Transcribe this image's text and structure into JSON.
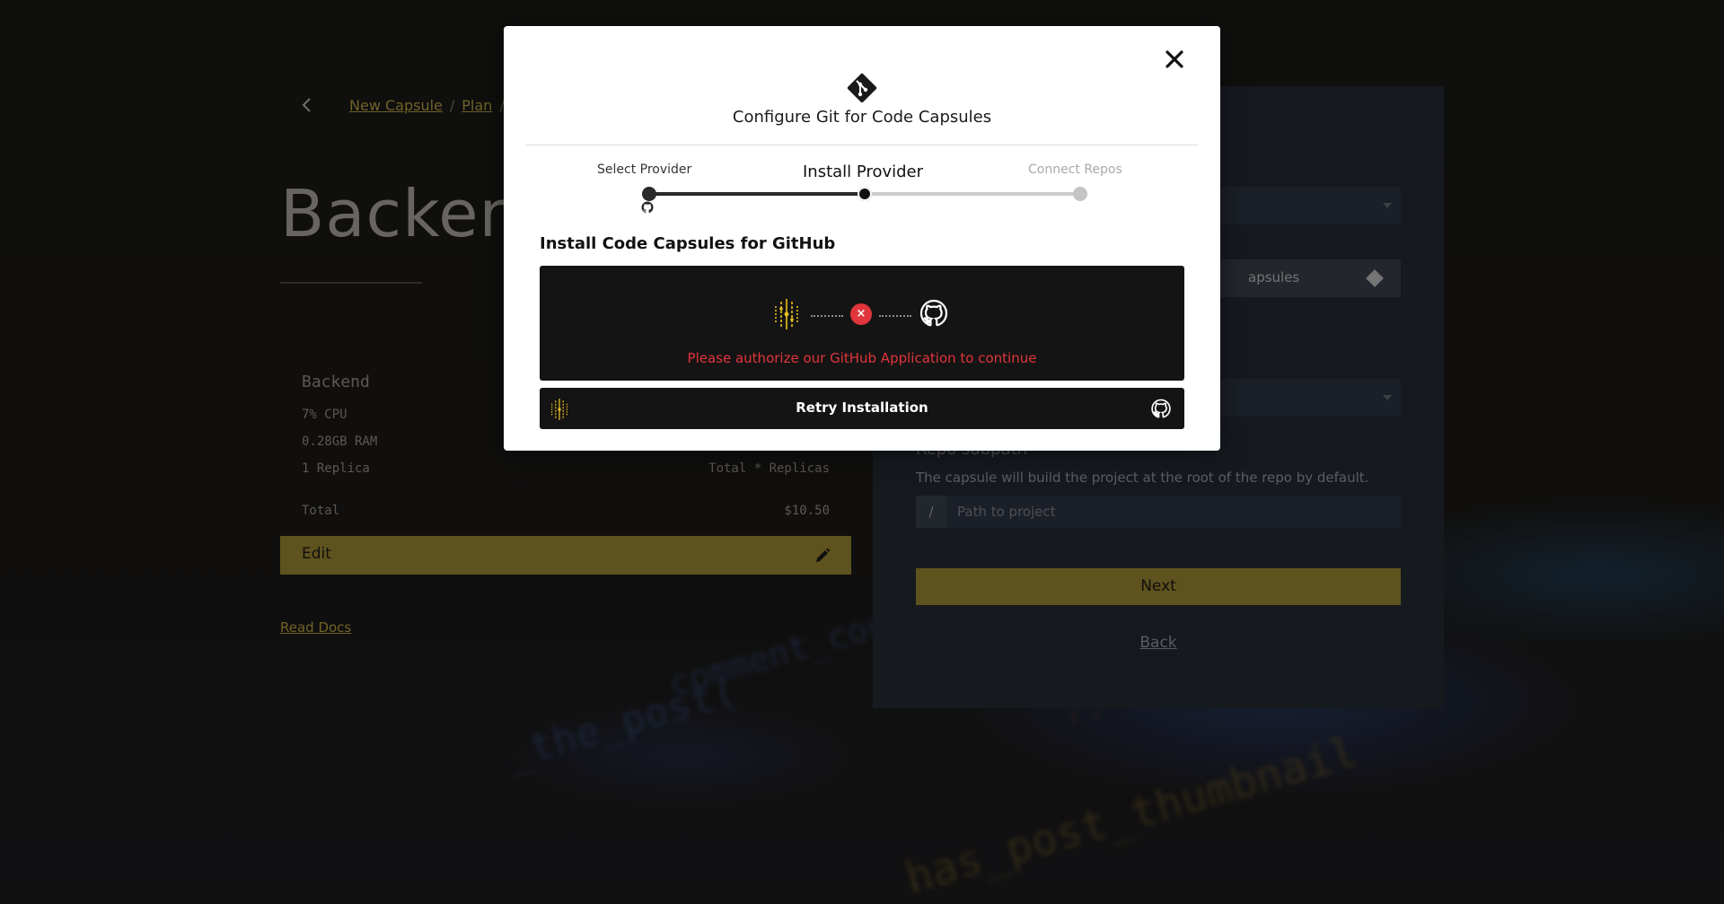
{
  "breadcrumb": {
    "items": [
      "New Capsule",
      "Plan"
    ]
  },
  "page": {
    "title": "Backend",
    "read_docs": "Read Docs"
  },
  "summary": {
    "name": "Backend",
    "cpu": "7% CPU",
    "ram": "0.28GB RAM",
    "replicas": "1 Replica",
    "formula": "Total * Replicas",
    "total_label": "Total",
    "total_value": "$10.50",
    "edit_label": "Edit"
  },
  "right_panel": {
    "git_bar_text": "apsules",
    "subpath_label": "Repo subpath",
    "subpath_help": "The capsule will build the project at the root of the repo by default.",
    "path_prefix": "/",
    "path_placeholder": "Path to project",
    "next_label": "Next",
    "back_label": "Back"
  },
  "modal": {
    "title": "Configure Git for Code Capsules",
    "steps": [
      "Select Provider",
      "Install Provider",
      "Connect Repos"
    ],
    "active_step": 1,
    "section_heading": "Install Code Capsules for GitHub",
    "error_message": "Please authorize our GitHub Application to continue",
    "error_glyph": "×",
    "retry_label": "Retry Installation"
  },
  "colors": {
    "accent": "#736425",
    "error": "#e0353c",
    "modal_bg": "#ffffff",
    "dark_box": "#151414"
  },
  "icons": [
    "close-icon",
    "git-icon",
    "github-icon",
    "code-capsules-logo-icon",
    "chevron-left-icon",
    "pencil-icon"
  ]
}
